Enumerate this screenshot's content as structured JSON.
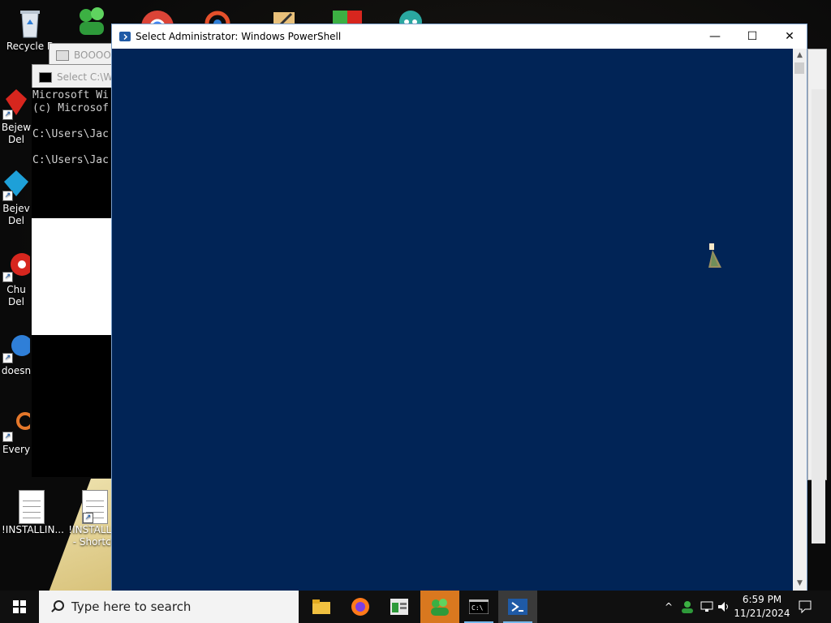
{
  "desktop": {
    "icons": [
      {
        "label": "Recycle B"
      },
      {
        "label": "Bejew\nDel"
      },
      {
        "label": "Bejev\nDel"
      },
      {
        "label": "Chu\nDel"
      },
      {
        "label": "doesn"
      },
      {
        "label": "Every"
      },
      {
        "label": "!INSTALLIN..."
      },
      {
        "label": "!INSTALLIN\n- Shortcu"
      }
    ]
  },
  "back_windows": {
    "booo_title": "BOOOOO",
    "cmd_title": "Select C:\\WIN",
    "cmd_text": "Microsoft Wi\n(c) Microsof\n\nC:\\Users\\Jac\n\nC:\\Users\\Jac"
  },
  "powershell": {
    "title": "Select Administrator: Windows PowerShell",
    "minimize_glyph": "—",
    "maximize_glyph": "☐",
    "close_glyph": "✕",
    "scroll_up": "▲",
    "scroll_down": "▼",
    "console_bg": "#012456"
  },
  "taskbar": {
    "search_placeholder": "Type here to search",
    "apps": [
      "file-explorer",
      "firefox",
      "notepad-like",
      "messenger",
      "command-prompt",
      "powershell"
    ],
    "clock_time": "6:59 PM",
    "clock_date": "11/21/2024"
  },
  "colors": {
    "accent": "#d9781f",
    "taskbar": "#101010"
  }
}
